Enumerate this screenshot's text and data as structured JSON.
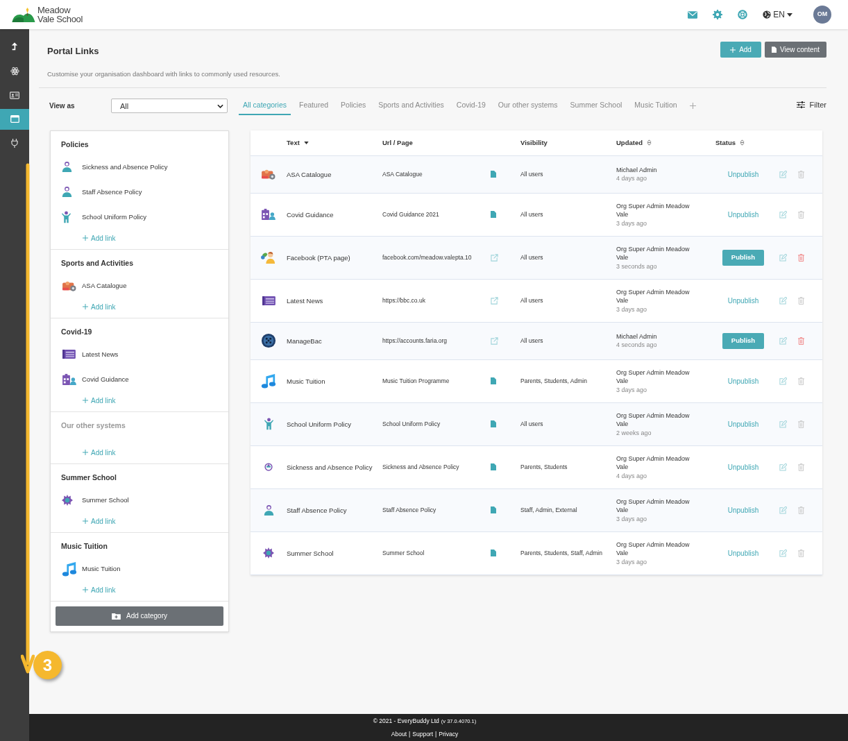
{
  "header": {
    "logo_line_1": "Meadow",
    "logo_line_2": "Vale School",
    "language": "EN",
    "avatar_initials": "OM"
  },
  "sidebar": {
    "items": [
      {
        "selected": false
      },
      {
        "selected": false
      },
      {
        "selected": false
      },
      {
        "selected": true
      },
      {
        "selected": false
      }
    ]
  },
  "page": {
    "title": "Portal Links",
    "description": "Customise your organisation dashboard with links to commonly used resources.",
    "add_button": "Add",
    "view_button": "View content"
  },
  "view_as": {
    "label": "View as",
    "value": "All"
  },
  "tabs": [
    {
      "label": "All categories",
      "selected": true
    },
    {
      "label": "Featured",
      "selected": false
    },
    {
      "label": "Policies",
      "selected": false
    },
    {
      "label": "Sports and Activities",
      "selected": false
    },
    {
      "label": "Covid-19",
      "selected": false
    },
    {
      "label": "Our other systems",
      "selected": false
    },
    {
      "label": "Summer School",
      "selected": false
    },
    {
      "label": "Music Tuition",
      "selected": false
    }
  ],
  "filter_label": "Filter",
  "categories": [
    {
      "title": "Policies",
      "muted": false,
      "links": [
        "Sickness and Absence Policy",
        "Staff Absence Policy",
        "School Uniform Policy"
      ],
      "add_link": "Add link"
    },
    {
      "title": "Sports and Activities",
      "muted": false,
      "links": [
        "ASA Catalogue"
      ],
      "add_link": "Add link"
    },
    {
      "title": "Covid-19",
      "muted": false,
      "links": [
        "Latest News",
        "Covid Guidance"
      ],
      "add_link": "Add link"
    },
    {
      "title": "Our other systems",
      "muted": true,
      "add_link": "Add link"
    },
    {
      "title": "Summer School",
      "muted": false,
      "links": [
        "Summer School"
      ],
      "add_link": "Add link"
    },
    {
      "title": "Music Tuition",
      "muted": false,
      "links": [
        "Music Tuition"
      ],
      "add_link": "Add link"
    }
  ],
  "add_category": "Add category",
  "table": {
    "columns": [
      {
        "label": "Text",
        "sorted": true
      },
      {
        "label": "Url / Page"
      },
      {
        "label": "Visibility"
      },
      {
        "label": "Updated",
        "sorted": false
      },
      {
        "label": "Status",
        "sorted": false
      }
    ],
    "rows": [
      {
        "text": "ASA Catalogue",
        "url": "ASA Catalogue",
        "kind": "page",
        "visibility": "All users",
        "updated_by": "Michael Admin",
        "updated_when": "4 days ago",
        "status_action": "Unpublish",
        "published": true
      },
      {
        "text": "Covid Guidance",
        "url": "Covid Guidance 2021",
        "kind": "page",
        "visibility": "All users",
        "updated_by": "Org Super Admin Meadow Vale",
        "updated_when": "3 days ago",
        "status_action": "Unpublish",
        "published": true
      },
      {
        "text": "Facebook (PTA page)",
        "url": "facebook.com/meadow.valepta.10",
        "kind": "url",
        "visibility": "All users",
        "updated_by": "Org Super Admin Meadow Vale",
        "updated_when": "3 seconds ago",
        "status_action": "Publish",
        "published": false
      },
      {
        "text": "Latest News",
        "url": "https://bbc.co.uk",
        "kind": "url",
        "visibility": "All users",
        "updated_by": "Org Super Admin Meadow Vale",
        "updated_when": "3 days ago",
        "status_action": "Unpublish",
        "published": true
      },
      {
        "text": "ManageBac",
        "url": "https://accounts.faria.org",
        "kind": "url",
        "visibility": "All users",
        "updated_by": "Michael Admin",
        "updated_when": "4 seconds ago",
        "status_action": "Publish",
        "published": false
      },
      {
        "text": "Music Tuition",
        "url": "Music Tuition Programme",
        "kind": "page",
        "visibility": "Parents, Students, Admin",
        "updated_by": "Org Super Admin Meadow Vale",
        "updated_when": "3 days ago",
        "status_action": "Unpublish",
        "published": true
      },
      {
        "text": "School Uniform Policy",
        "url": "School Uniform Policy",
        "kind": "page",
        "visibility": "All users",
        "updated_by": "Org Super Admin Meadow Vale",
        "updated_when": "2 weeks ago",
        "status_action": "Unpublish",
        "published": true
      },
      {
        "text": "Sickness and Absence Policy",
        "url": "Sickness and Absence Policy",
        "kind": "page",
        "visibility": "Parents, Students",
        "updated_by": "Org Super Admin Meadow Vale",
        "updated_when": "4 days ago",
        "status_action": "Unpublish",
        "published": true
      },
      {
        "text": "Staff Absence Policy",
        "url": "Staff Absence Policy",
        "kind": "page",
        "visibility": "Staff, Admin, External",
        "updated_by": "Org Super Admin Meadow Vale",
        "updated_when": "3 days ago",
        "status_action": "Unpublish",
        "published": true
      },
      {
        "text": "Summer School",
        "url": "Summer School",
        "kind": "page",
        "visibility": "Parents, Students, Staff, Admin",
        "updated_by": "Org Super Admin Meadow Vale",
        "updated_when": "3 days ago",
        "status_action": "Unpublish",
        "published": true
      }
    ]
  },
  "footer": {
    "copyright": "© 2021 - EveryBuddy Ltd",
    "version": "(v 37.0.4070.1)",
    "links": [
      "About",
      "Support",
      "Privacy"
    ],
    "separator": "|"
  },
  "annotation": {
    "step": "3"
  }
}
